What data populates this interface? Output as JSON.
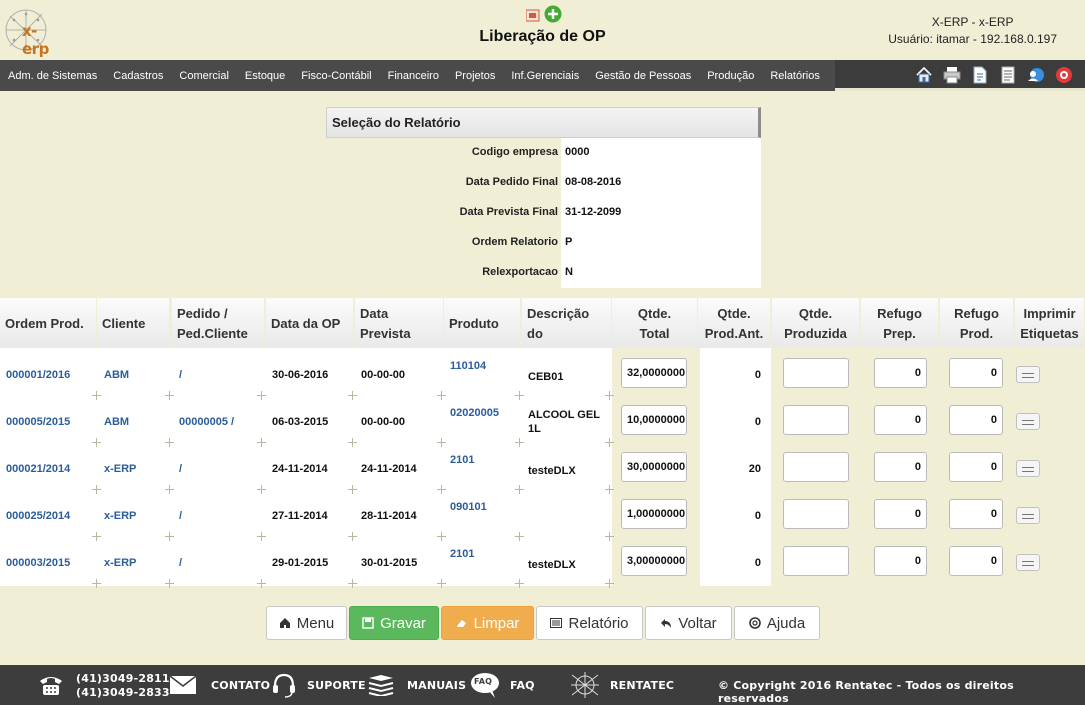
{
  "header": {
    "logo_text": "x-erp",
    "title": "Liberação de OP",
    "system": "X-ERP - x-ERP",
    "user": "Usuário: itamar - 192.168.0.197"
  },
  "menu": [
    "Adm. de Sistemas",
    "Cadastros",
    "Comercial",
    "Estoque",
    "Fisco-Contábil",
    "Financeiro",
    "Projetos",
    "Inf.Gerenciais",
    "Gestão de Pessoas",
    "Produção",
    "Relatórios"
  ],
  "toolbar_icons": [
    "home-icon",
    "printer-icon",
    "document-icon",
    "report-icon",
    "users-icon",
    "help-lifebuoy-icon"
  ],
  "selection": {
    "title": "Seleção do Relatório",
    "fields": [
      {
        "label": "Codigo empresa",
        "value": "0000"
      },
      {
        "label": "Data Pedido Final",
        "value": "08-08-2016"
      },
      {
        "label": "Data Prevista Final",
        "value": "31-12-2099"
      },
      {
        "label": "Ordem Relatorio",
        "value": "P"
      },
      {
        "label": "Relexportacao",
        "value": "N"
      }
    ]
  },
  "table": {
    "headers": {
      "ordem": "Ordem Prod.",
      "cliente": "Cliente",
      "pedido_1": "Pedido /",
      "pedido_2": "Ped.Cliente",
      "data_op": "Data da OP",
      "data_prev": "Data Prevista",
      "produto": "Produto",
      "desc_1": "Descrição do",
      "desc_2": "Produto",
      "total_1": "Qtde.",
      "total_2": "Total",
      "ant_1": "Qtde.",
      "ant_2": "Prod.Ant.",
      "prod_1": "Qtde.",
      "prod_2": "Produzida",
      "refprep_1": "Refugo",
      "refprep_2": "Prep.",
      "refprod_1": "Refugo",
      "refprod_2": "Prod.",
      "imp_1": "Imprimir",
      "imp_2": "Etiquetas"
    },
    "rows": [
      {
        "ordem": "000001/2016",
        "cliente": "ABM",
        "pedido": "/",
        "data_op": "30-06-2016",
        "data_prev": "00-00-00",
        "produto": "110104",
        "desc_1": "CEB01",
        "desc_2": "",
        "qtde_total": "32,0000000",
        "qtde_ant": "0",
        "qtde_prod": "",
        "ref_prep": "0",
        "ref_prod": "0"
      },
      {
        "ordem": "000005/2015",
        "cliente": "ABM",
        "pedido": "00000005 /",
        "data_op": "06-03-2015",
        "data_prev": "00-00-00",
        "produto": "02020005",
        "desc_1": "ALCOOL GEL",
        "desc_2": "1L",
        "qtde_total": "10,0000000",
        "qtde_ant": "0",
        "qtde_prod": "",
        "ref_prep": "0",
        "ref_prod": "0"
      },
      {
        "ordem": "000021/2014",
        "cliente": "x-ERP",
        "pedido": "/",
        "data_op": "24-11-2014",
        "data_prev": "24-11-2014",
        "produto": "2101",
        "desc_1": "testeDLX",
        "desc_2": "",
        "qtde_total": "30,0000000",
        "qtde_ant": "20",
        "qtde_prod": "",
        "ref_prep": "0",
        "ref_prod": "0"
      },
      {
        "ordem": "000025/2014",
        "cliente": "x-ERP",
        "pedido": "/",
        "data_op": "27-11-2014",
        "data_prev": "28-11-2014",
        "produto": "090101",
        "desc_1": "",
        "desc_2": "",
        "qtde_total": "1,00000000",
        "qtde_ant": "0",
        "qtde_prod": "",
        "ref_prep": "0",
        "ref_prod": "0"
      },
      {
        "ordem": "000003/2015",
        "cliente": "x-ERP",
        "pedido": "/",
        "data_op": "29-01-2015",
        "data_prev": "30-01-2015",
        "produto": "2101",
        "desc_1": "testeDLX",
        "desc_2": "",
        "qtde_total": "3,00000000",
        "qtde_ant": "0",
        "qtde_prod": "",
        "ref_prep": "0",
        "ref_prod": "0"
      }
    ]
  },
  "buttons": {
    "menu": "Menu",
    "gravar": "Gravar",
    "limpar": "Limpar",
    "relatorio": "Relatório",
    "voltar": "Voltar",
    "ajuda": "Ajuda"
  },
  "footer": {
    "phone_1": "(41)3049-2811",
    "phone_2": "(41)3049-2833",
    "contato": "CONTATO",
    "suporte": "SUPORTE",
    "manuais": "MANUAIS",
    "faq": "FAQ",
    "faq_icon_text": "FAQ",
    "rentatec": "RENTATEC",
    "copyright": "© Copyright 2016 Rentatec - Todos os direitos reservados"
  },
  "colors": {
    "background": "#f0efd6",
    "menubar": "#4a4a4a",
    "link": "#2a5d9a",
    "gravar": "#5cb85c",
    "limpar": "#f0ad4e",
    "footer": "#3d3d3d"
  }
}
